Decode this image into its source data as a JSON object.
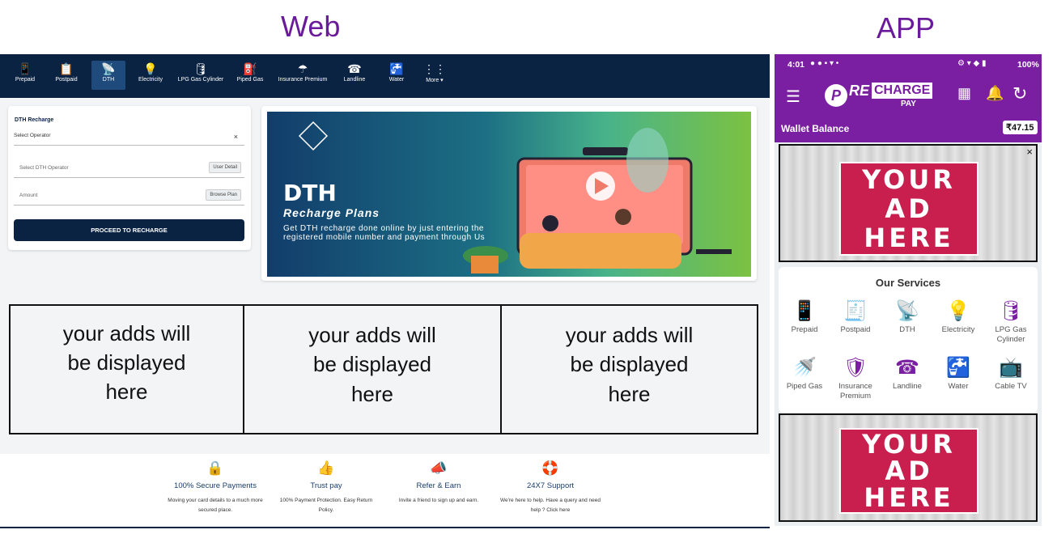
{
  "headings": {
    "web": "Web",
    "app": "APP"
  },
  "web": {
    "nav": [
      {
        "label": "Prepaid",
        "icon": "📱"
      },
      {
        "label": "Postpaid",
        "icon": "📋"
      },
      {
        "label": "DTH",
        "icon": "📡"
      },
      {
        "label": "Electricity",
        "icon": "💡"
      },
      {
        "label": "LPG Gas Cylinder",
        "icon": "🛢"
      },
      {
        "label": "Piped Gas",
        "icon": "⛽"
      },
      {
        "label": "Insurance Premium",
        "icon": "☂"
      },
      {
        "label": "Landline",
        "icon": "☎"
      },
      {
        "label": "Water",
        "icon": "🚰"
      },
      {
        "label": "More ▾",
        "icon": "⋮⋮"
      }
    ],
    "form": {
      "title": "DTH Recharge",
      "select_operator": "Select Operator",
      "clear": "×",
      "dth_operator_placeholder": "Select DTH Operator",
      "user_detail_btn": "User Detail",
      "amount_placeholder": "Amount",
      "browse_plan_btn": "Browse Plan",
      "proceed": "PROCEED TO RECHARGE"
    },
    "banner": {
      "title": "DTH",
      "subtitle": "Recharge Plans",
      "text": "Get DTH recharge done online by just entering the registered mobile number and payment through Us"
    },
    "ads": [
      {
        "line1": "your adds will",
        "line2": "be displayed",
        "line3": "here"
      },
      {
        "line1": "your adds will",
        "line2": "be displayed",
        "line3": "here"
      },
      {
        "line1": "your adds will",
        "line2": "be displayed",
        "line3": "here"
      }
    ],
    "features": [
      {
        "icon": "🔒",
        "title": "100% Secure Payments",
        "desc1": "Moving your card details to a much more",
        "desc2": "secured place."
      },
      {
        "icon": "👍",
        "title": "Trust pay",
        "desc1": "100% Payment Protection. Easy Return",
        "desc2": "Policy."
      },
      {
        "icon": "📣",
        "title": "Refer & Earn",
        "desc1": "Invite a friend to sign up and earn.",
        "desc2": ""
      },
      {
        "icon": "🛟",
        "title": "24X7 Support",
        "desc1": "We're here to help. Have a query and need",
        "desc2": "help ? Click here"
      }
    ]
  },
  "app": {
    "status": {
      "time": "4:01",
      "battery": "100%"
    },
    "brand": {
      "logo_p": "P",
      "logo_re": "RE",
      "logo_charge": "CHARGE",
      "logo_pay": "PAY"
    },
    "wallet": {
      "label": "Wallet Balance",
      "amount": "₹47.15"
    },
    "ad": {
      "line1": "YOUR",
      "line2": "AD",
      "line3": "HERE",
      "close": "×"
    },
    "services_title": "Our Services",
    "services": [
      {
        "label": "Prepaid",
        "icon": "📱"
      },
      {
        "label": "Postpaid",
        "icon": "🧾"
      },
      {
        "label": "DTH",
        "icon": "📡"
      },
      {
        "label": "Electricity",
        "icon": "💡"
      },
      {
        "label": "LPG Gas Cylinder",
        "icon": "🛢"
      },
      {
        "label": "Piped Gas",
        "icon": "🚿"
      },
      {
        "label": "Insurance Premium",
        "icon": "🛡"
      },
      {
        "label": "Landline",
        "icon": "☎"
      },
      {
        "label": "Water",
        "icon": "🚰"
      },
      {
        "label": "Cable TV",
        "icon": "📺"
      }
    ]
  },
  "colors": {
    "navy": "#0b2343",
    "purple": "#7b1fa2",
    "ad_red": "#c81f4e"
  }
}
